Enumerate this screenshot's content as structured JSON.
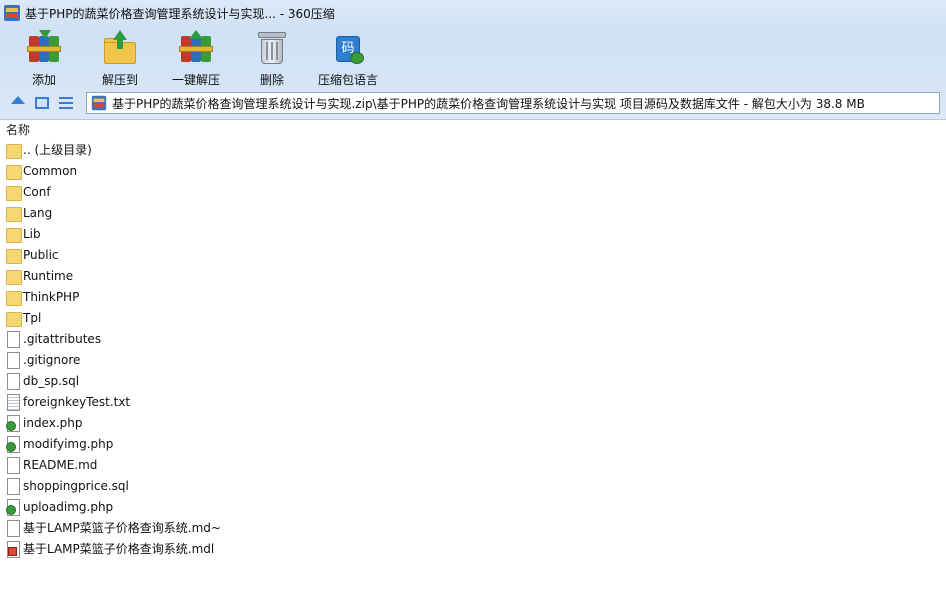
{
  "window": {
    "title": "基于PHP的蔬菜价格查询管理系统设计与实现... - 360压缩"
  },
  "toolbar": {
    "add_label": "添加",
    "extract_to_label": "解压到",
    "one_click_extract_label": "一键解压",
    "delete_label": "删除",
    "language_label": "压缩包语言",
    "language_icon_glyph": "码"
  },
  "address": {
    "path": "基于PHP的蔬菜价格查询管理系统设计与实现.zip\\基于PHP的蔬菜价格查询管理系统设计与实现 项目源码及数据库文件 - 解包大小为 38.8 MB"
  },
  "list": {
    "column_name": "名称",
    "items": [
      {
        "name": ".. (上级目录)",
        "type": "folder"
      },
      {
        "name": "Common",
        "type": "folder"
      },
      {
        "name": "Conf",
        "type": "folder"
      },
      {
        "name": "Lang",
        "type": "folder"
      },
      {
        "name": "Lib",
        "type": "folder"
      },
      {
        "name": "Public",
        "type": "folder"
      },
      {
        "name": "Runtime",
        "type": "folder"
      },
      {
        "name": "ThinkPHP",
        "type": "folder"
      },
      {
        "name": "Tpl",
        "type": "folder"
      },
      {
        "name": ".gitattributes",
        "type": "file"
      },
      {
        "name": ".gitignore",
        "type": "file"
      },
      {
        "name": "db_sp.sql",
        "type": "file"
      },
      {
        "name": "foreignkeyTest.txt",
        "type": "txt"
      },
      {
        "name": "index.php",
        "type": "php"
      },
      {
        "name": "modifyimg.php",
        "type": "php"
      },
      {
        "name": "README.md",
        "type": "file"
      },
      {
        "name": "shoppingprice.sql",
        "type": "file"
      },
      {
        "name": "uploadimg.php",
        "type": "php"
      },
      {
        "name": "基于LAMP菜篮子价格查询系统.md~",
        "type": "file"
      },
      {
        "name": "基于LAMP菜篮子价格查询系统.mdl",
        "type": "mdl"
      }
    ]
  }
}
